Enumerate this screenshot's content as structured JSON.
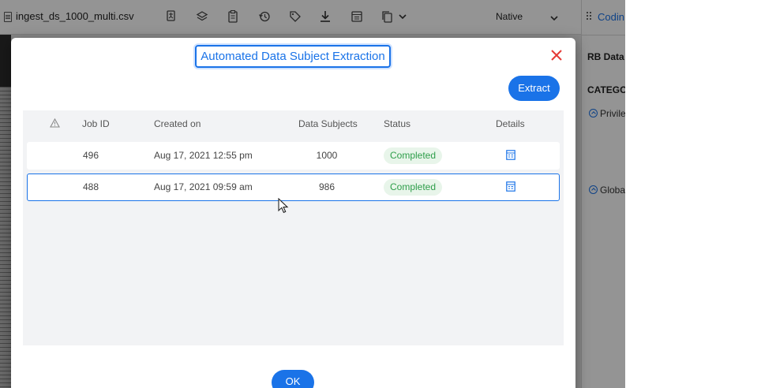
{
  "app": {
    "file_name": "ingest_ds_1000_multi.csv",
    "view_mode": "Native",
    "toolbar_icons": [
      "translate-icon",
      "layers-icon",
      "clipboard-icon",
      "history-icon",
      "tag-icon",
      "download-icon",
      "panel-icon",
      "copy-icon",
      "chevron-down-icon"
    ],
    "right_panel": {
      "tab_label": "Codin",
      "section_title": "RB Data",
      "category_label": "CATEGO",
      "items": [
        "Privile",
        "Globa"
      ]
    }
  },
  "modal": {
    "title": "Automated Data Subject Extraction",
    "extract_label": "Extract",
    "ok_label": "OK",
    "table": {
      "columns": [
        "Job ID",
        "Created on",
        "Data Subjects",
        "Status",
        "Details"
      ],
      "rows": [
        {
          "job_id": "496",
          "created_on": "Aug 17, 2021 12:55 pm",
          "data_subjects": "1000",
          "status": "Completed",
          "selected": false
        },
        {
          "job_id": "488",
          "created_on": "Aug 17, 2021 09:59 am",
          "data_subjects": "986",
          "status": "Completed",
          "selected": true
        }
      ]
    }
  },
  "colors": {
    "accent": "#1a73e8",
    "close": "#e53935",
    "status_text": "#2e9e4a",
    "status_bg": "#e8f5ea",
    "overlay": "rgba(0,0,0,0.42)"
  }
}
